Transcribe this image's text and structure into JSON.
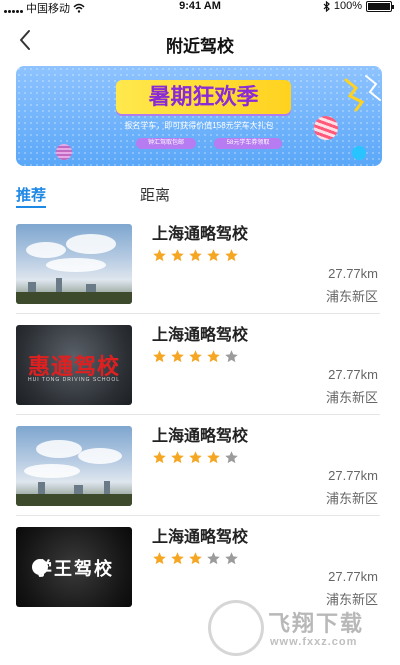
{
  "status_bar": {
    "carrier": "中国移动",
    "time": "9:41 AM",
    "battery": "100%"
  },
  "nav": {
    "title": "附近驾校"
  },
  "banner": {
    "title": "暑期狂欢季",
    "subtitle": "报名学车，即可获得价值158元学车大礼包",
    "button_1": "钟汇驾取包邮",
    "button_2": "58元学车券领取"
  },
  "tabs": [
    {
      "label": "推荐",
      "active": true
    },
    {
      "label": "距离",
      "active": false
    }
  ],
  "schools": [
    {
      "name": "上海通略驾校",
      "rating": 5,
      "distance": "27.77km",
      "district": "浦东新区",
      "thumb": "sky-photo"
    },
    {
      "name": "上海通略驾校",
      "rating": 4,
      "distance": "27.77km",
      "district": "浦东新区",
      "thumb": "huitong-logo",
      "logo_text": "惠通驾校",
      "logo_sub": "HUI TONG DRIVING SCHOOL"
    },
    {
      "name": "上海通略驾校",
      "rating": 4,
      "distance": "27.77km",
      "district": "浦东新区",
      "thumb": "sky-photo"
    },
    {
      "name": "上海通略驾校",
      "rating": 3,
      "distance": "27.77km",
      "district": "浦东新区",
      "thumb": "xuewang-logo",
      "logo_text": "学王驾校"
    }
  ],
  "colors": {
    "accent": "#1e88e5",
    "star_filled": "#f5a623",
    "star_empty": "#9b9b9b"
  },
  "watermark": {
    "text": "飞翔下载",
    "url": "www.fxxz.com"
  }
}
